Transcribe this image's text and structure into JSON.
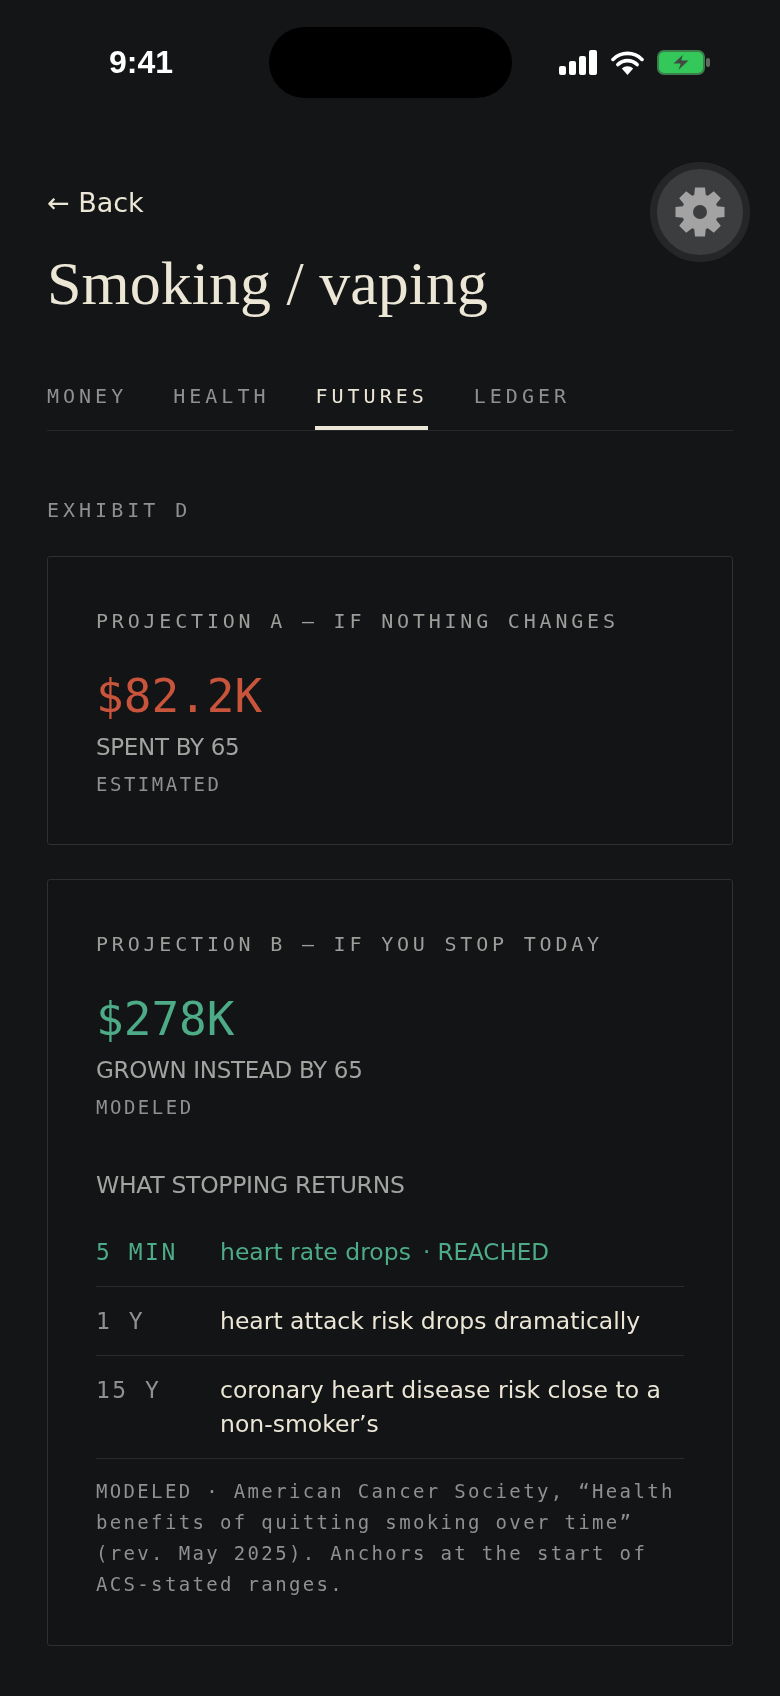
{
  "status_bar": {
    "time": "9:41"
  },
  "header": {
    "back_label": "← Back",
    "title": "Smoking / vaping"
  },
  "tabs": [
    {
      "label": "MONEY",
      "selected": false
    },
    {
      "label": "HEALTH",
      "selected": false
    },
    {
      "label": "FUTURES",
      "selected": true
    },
    {
      "label": "LEDGER",
      "selected": false
    }
  ],
  "section_label": "EXHIBIT D",
  "projections": [
    {
      "kind": "cost",
      "label": "PROJECTION A — IF NOTHING CHANGES",
      "amount": "$82.2K",
      "caption": "SPENT BY 65",
      "basis": "ESTIMATED"
    },
    {
      "kind": "gain",
      "label": "PROJECTION B — IF YOU STOP TODAY",
      "amount": "$278K",
      "caption": "GROWN INSTEAD BY 65",
      "basis": "MODELED",
      "returns": {
        "title": "WHAT STOPPING RETURNS",
        "milestones": [
          {
            "time": "5 MIN",
            "text": "heart rate drops",
            "badge": "· REACHED",
            "reached": true
          },
          {
            "time": "1 Y",
            "text": "heart attack risk drops dramatically",
            "reached": false
          },
          {
            "time": "15 Y",
            "text": "coronary heart disease risk close to a non-smoker’s",
            "reached": false
          }
        ],
        "note": "MODELED · American Cancer Society, “Health benefits of quitting smoking over time” (rev. May 2025). Anchors at the start of ACS-stated ranges."
      }
    }
  ]
}
